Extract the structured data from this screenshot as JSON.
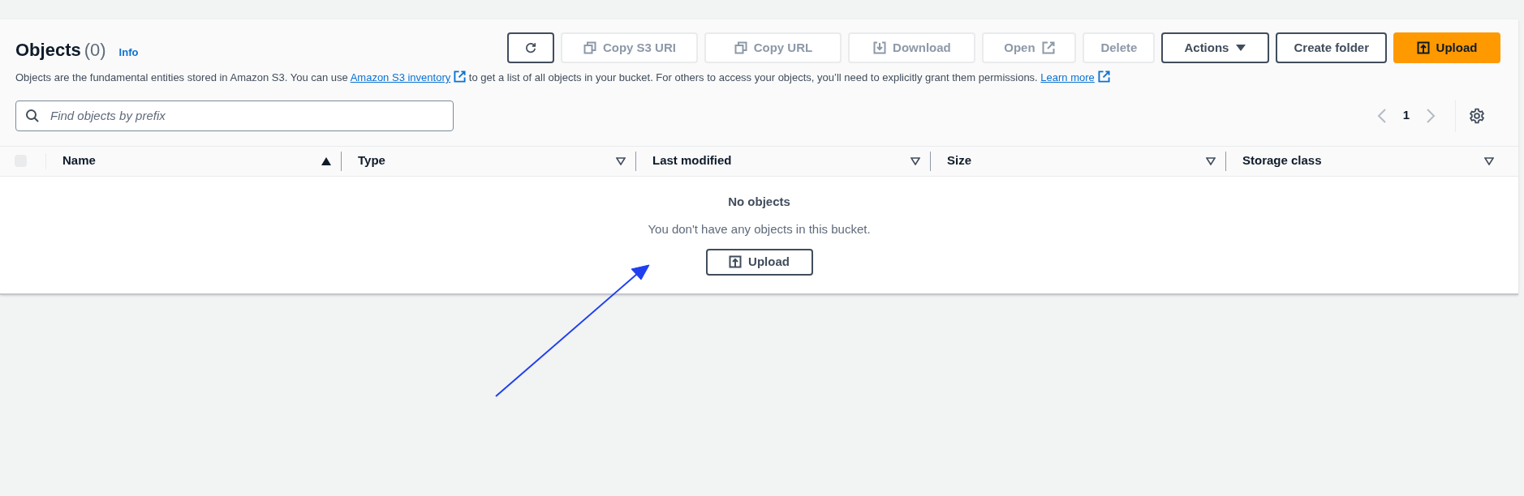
{
  "header": {
    "title": "Objects",
    "count": "(0)",
    "info": "Info"
  },
  "toolbar": [
    {
      "kind": "refresh",
      "disabled": false
    },
    {
      "kind": "copy",
      "label": "Copy S3 URI",
      "disabled": true
    },
    {
      "kind": "copy",
      "label": "Copy URL",
      "disabled": true
    },
    {
      "kind": "download",
      "label": "Download",
      "disabled": true
    },
    {
      "kind": "open",
      "label": "Open",
      "disabled": true
    },
    {
      "kind": "plain",
      "label": "Delete",
      "disabled": true
    },
    {
      "kind": "menu",
      "label": "Actions",
      "disabled": false
    },
    {
      "kind": "plain",
      "label": "Create folder",
      "disabled": false
    },
    {
      "kind": "primary",
      "label": "Upload",
      "disabled": false
    }
  ],
  "description": [
    {
      "kind": "text",
      "text": "Objects are the fundamental entities stored in Amazon S3. You can use "
    },
    {
      "kind": "link",
      "text": "Amazon S3 inventory"
    },
    {
      "kind": "text",
      "text": " to get a list of all objects in your bucket. For others to access your objects, you’ll need to explicitly grant them permissions. "
    },
    {
      "kind": "link",
      "text": "Learn more"
    }
  ],
  "search": {
    "placeholder": "Find objects by prefix"
  },
  "pagination": {
    "page": "1",
    "prev_disabled": true,
    "next_disabled": true
  },
  "table": {
    "select_all": {
      "checked": false
    },
    "columns": [
      {
        "label": "Name",
        "sorted": true
      },
      {
        "label": "Type",
        "sorted": false
      },
      {
        "label": "Last modified",
        "sorted": false
      },
      {
        "label": "Size",
        "sorted": false
      },
      {
        "label": "Storage class",
        "sorted": false
      }
    ]
  },
  "empty_state": {
    "title": "No objects",
    "message": "You don't have any objects in this bucket.",
    "button": "Upload"
  }
}
